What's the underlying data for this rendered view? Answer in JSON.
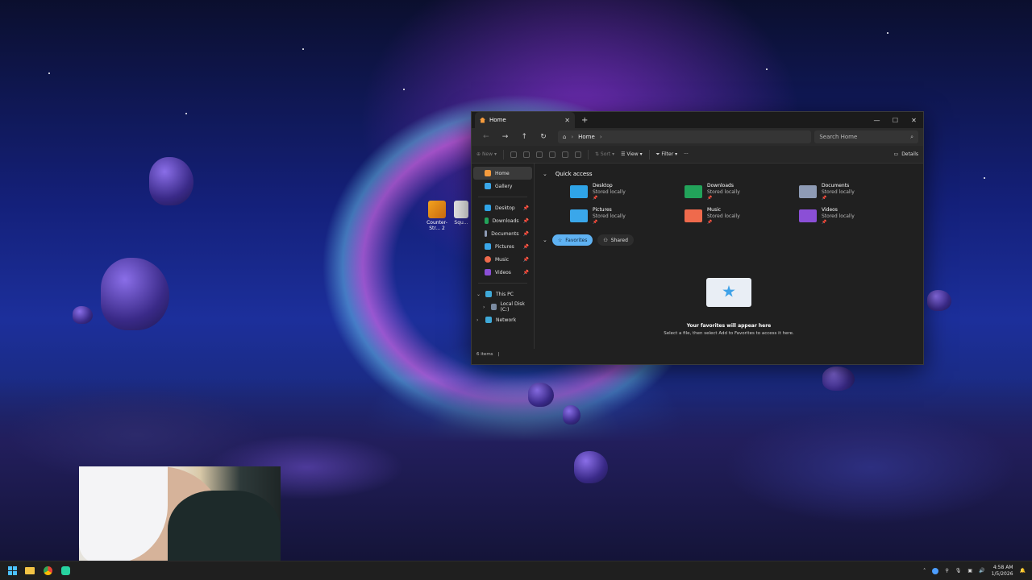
{
  "desktop": {
    "icons": [
      {
        "label": "Counter-Str... 2"
      },
      {
        "label": "Squ..."
      }
    ]
  },
  "explorer": {
    "tab_label": "Home",
    "nav": {
      "address_home_icon": "home-icon",
      "breadcrumb": "Home"
    },
    "search_placeholder": "Search Home",
    "toolbar": {
      "new_label": "New",
      "sort_label": "Sort",
      "view_label": "View",
      "filter_label": "Filter",
      "more_label": "···",
      "details_label": "Details"
    },
    "sidebar": {
      "home": "Home",
      "gallery": "Gallery",
      "pinned": [
        "Desktop",
        "Downloads",
        "Documents",
        "Pictures",
        "Music",
        "Videos"
      ],
      "this_pc": "This PC",
      "local_disk": "Local Disk (C:)",
      "network": "Network"
    },
    "quick_access": {
      "title": "Quick access",
      "items": [
        {
          "name": "Desktop",
          "sub": "Stored locally",
          "color": "#2fa4e7"
        },
        {
          "name": "Downloads",
          "sub": "Stored locally",
          "color": "#22a35a"
        },
        {
          "name": "Documents",
          "sub": "Stored locally",
          "color": "#8e9bb5"
        },
        {
          "name": "Pictures",
          "sub": "Stored locally",
          "color": "#3aa7ea"
        },
        {
          "name": "Music",
          "sub": "Stored locally",
          "color": "#ef6a4c"
        },
        {
          "name": "Videos",
          "sub": "Stored locally",
          "color": "#8b4fd6"
        }
      ]
    },
    "pills": {
      "favorites": "Favorites",
      "shared": "Shared"
    },
    "empty": {
      "title": "Your favorites will appear here",
      "subtitle": "Select a file, then select Add to Favorites to access it here."
    },
    "status": "6 items"
  },
  "taskbar": {
    "time": "4:58 AM",
    "date": "1/5/2026"
  }
}
